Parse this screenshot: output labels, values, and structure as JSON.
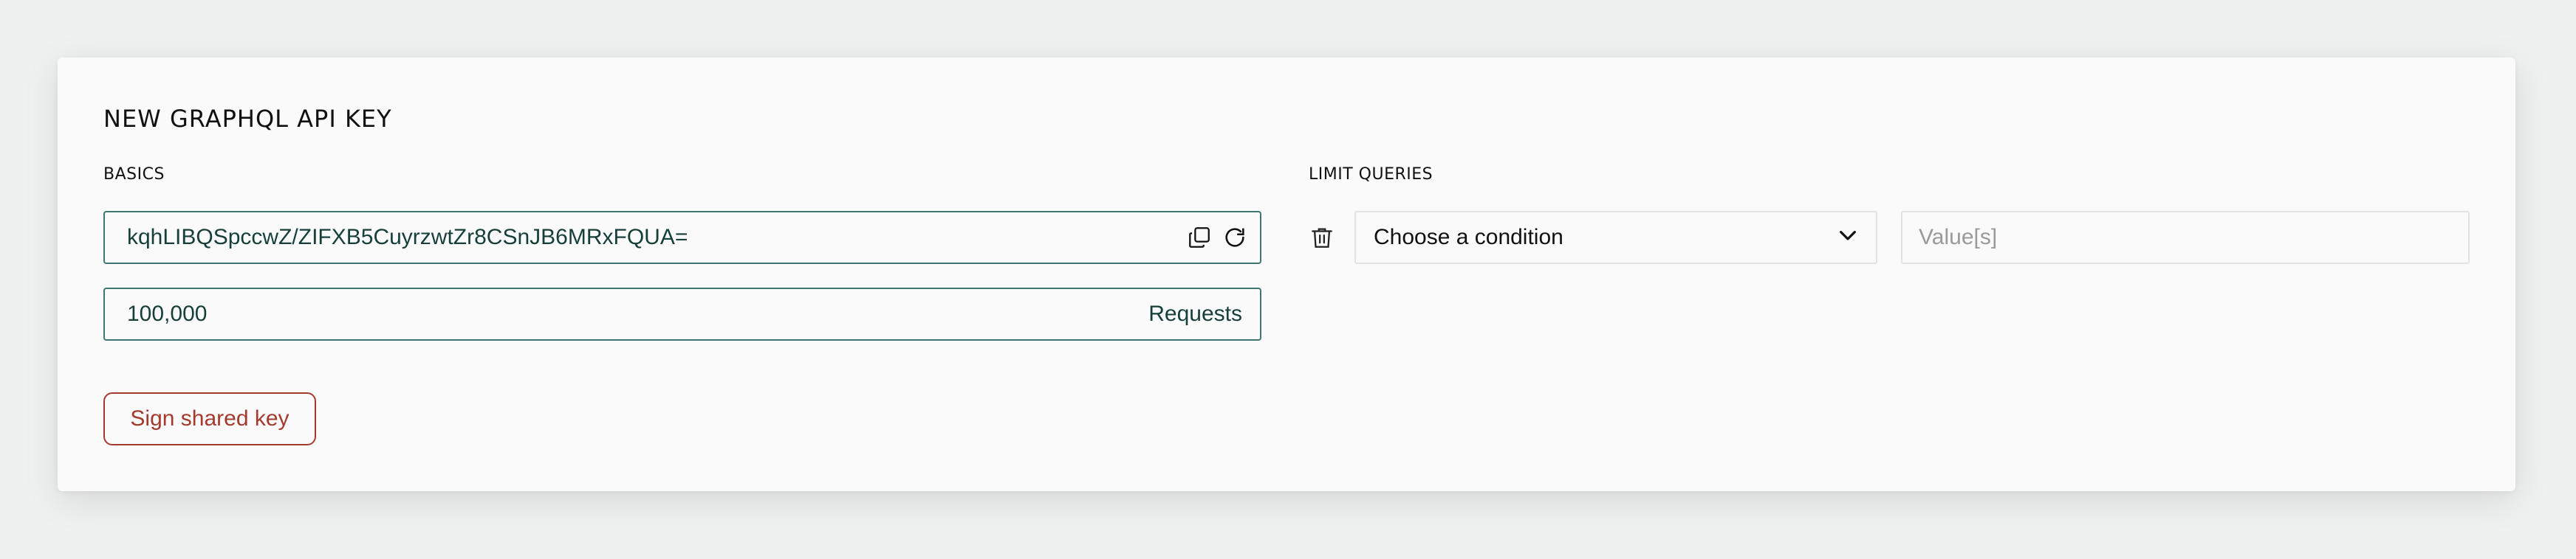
{
  "card": {
    "title": "NEW GRAPHQL API KEY"
  },
  "basics": {
    "label": "BASICS",
    "api_key_value": "kqhLIBQSpccwZ/ZIFXB5CuyrzwtZr8CSnJB6MRxFQUA=",
    "requests_value": "100,000",
    "requests_suffix": "Requests",
    "sign_button_label": "Sign shared key"
  },
  "limit_queries": {
    "label": "LIMIT QUERIES",
    "condition_selected": "Choose a condition",
    "value_placeholder": "Value[s]"
  },
  "colors": {
    "accent": "#3e7570",
    "danger": "#a33a2d"
  },
  "icons": [
    "copy-icon",
    "refresh-icon",
    "trash-icon",
    "chevron-down-icon"
  ]
}
